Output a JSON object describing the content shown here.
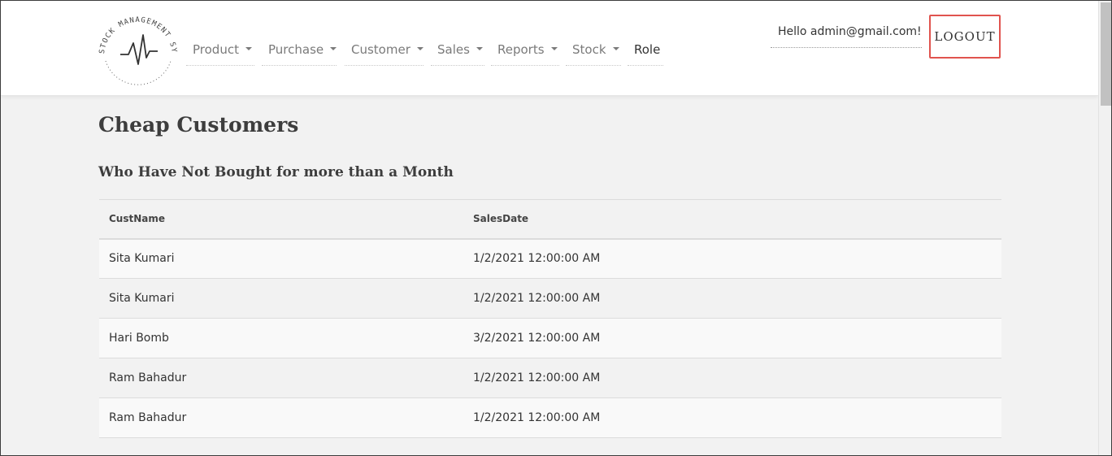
{
  "header": {
    "logo_text": "STOCK MANAGEMENT SYSTEM",
    "nav": [
      {
        "label": "Product",
        "dropdown": true
      },
      {
        "label": "Purchase",
        "dropdown": true
      },
      {
        "label": "Customer",
        "dropdown": true
      },
      {
        "label": "Sales",
        "dropdown": true
      },
      {
        "label": "Reports",
        "dropdown": true
      },
      {
        "label": "Stock",
        "dropdown": true
      },
      {
        "label": "Role",
        "dropdown": false
      }
    ],
    "greeting": "Hello admin@gmail.com!",
    "logout_label": "LOGOUT"
  },
  "main": {
    "title": "Cheap Customers",
    "subtitle": "Who Have Not Bought for more than a Month",
    "table": {
      "columns": [
        "CustName",
        "SalesDate"
      ],
      "rows": [
        [
          "Sita Kumari",
          "1/2/2021 12:00:00 AM"
        ],
        [
          "Sita Kumari",
          "1/2/2021 12:00:00 AM"
        ],
        [
          "Hari Bomb",
          "3/2/2021 12:00:00 AM"
        ],
        [
          "Ram Bahadur",
          "1/2/2021 12:00:00 AM"
        ],
        [
          "Ram Bahadur",
          "1/2/2021 12:00:00 AM"
        ]
      ]
    }
  },
  "colors": {
    "logout_border": "#e0534e",
    "page_bg": "#f2f2f2",
    "nav_text": "#7a7a7a"
  }
}
